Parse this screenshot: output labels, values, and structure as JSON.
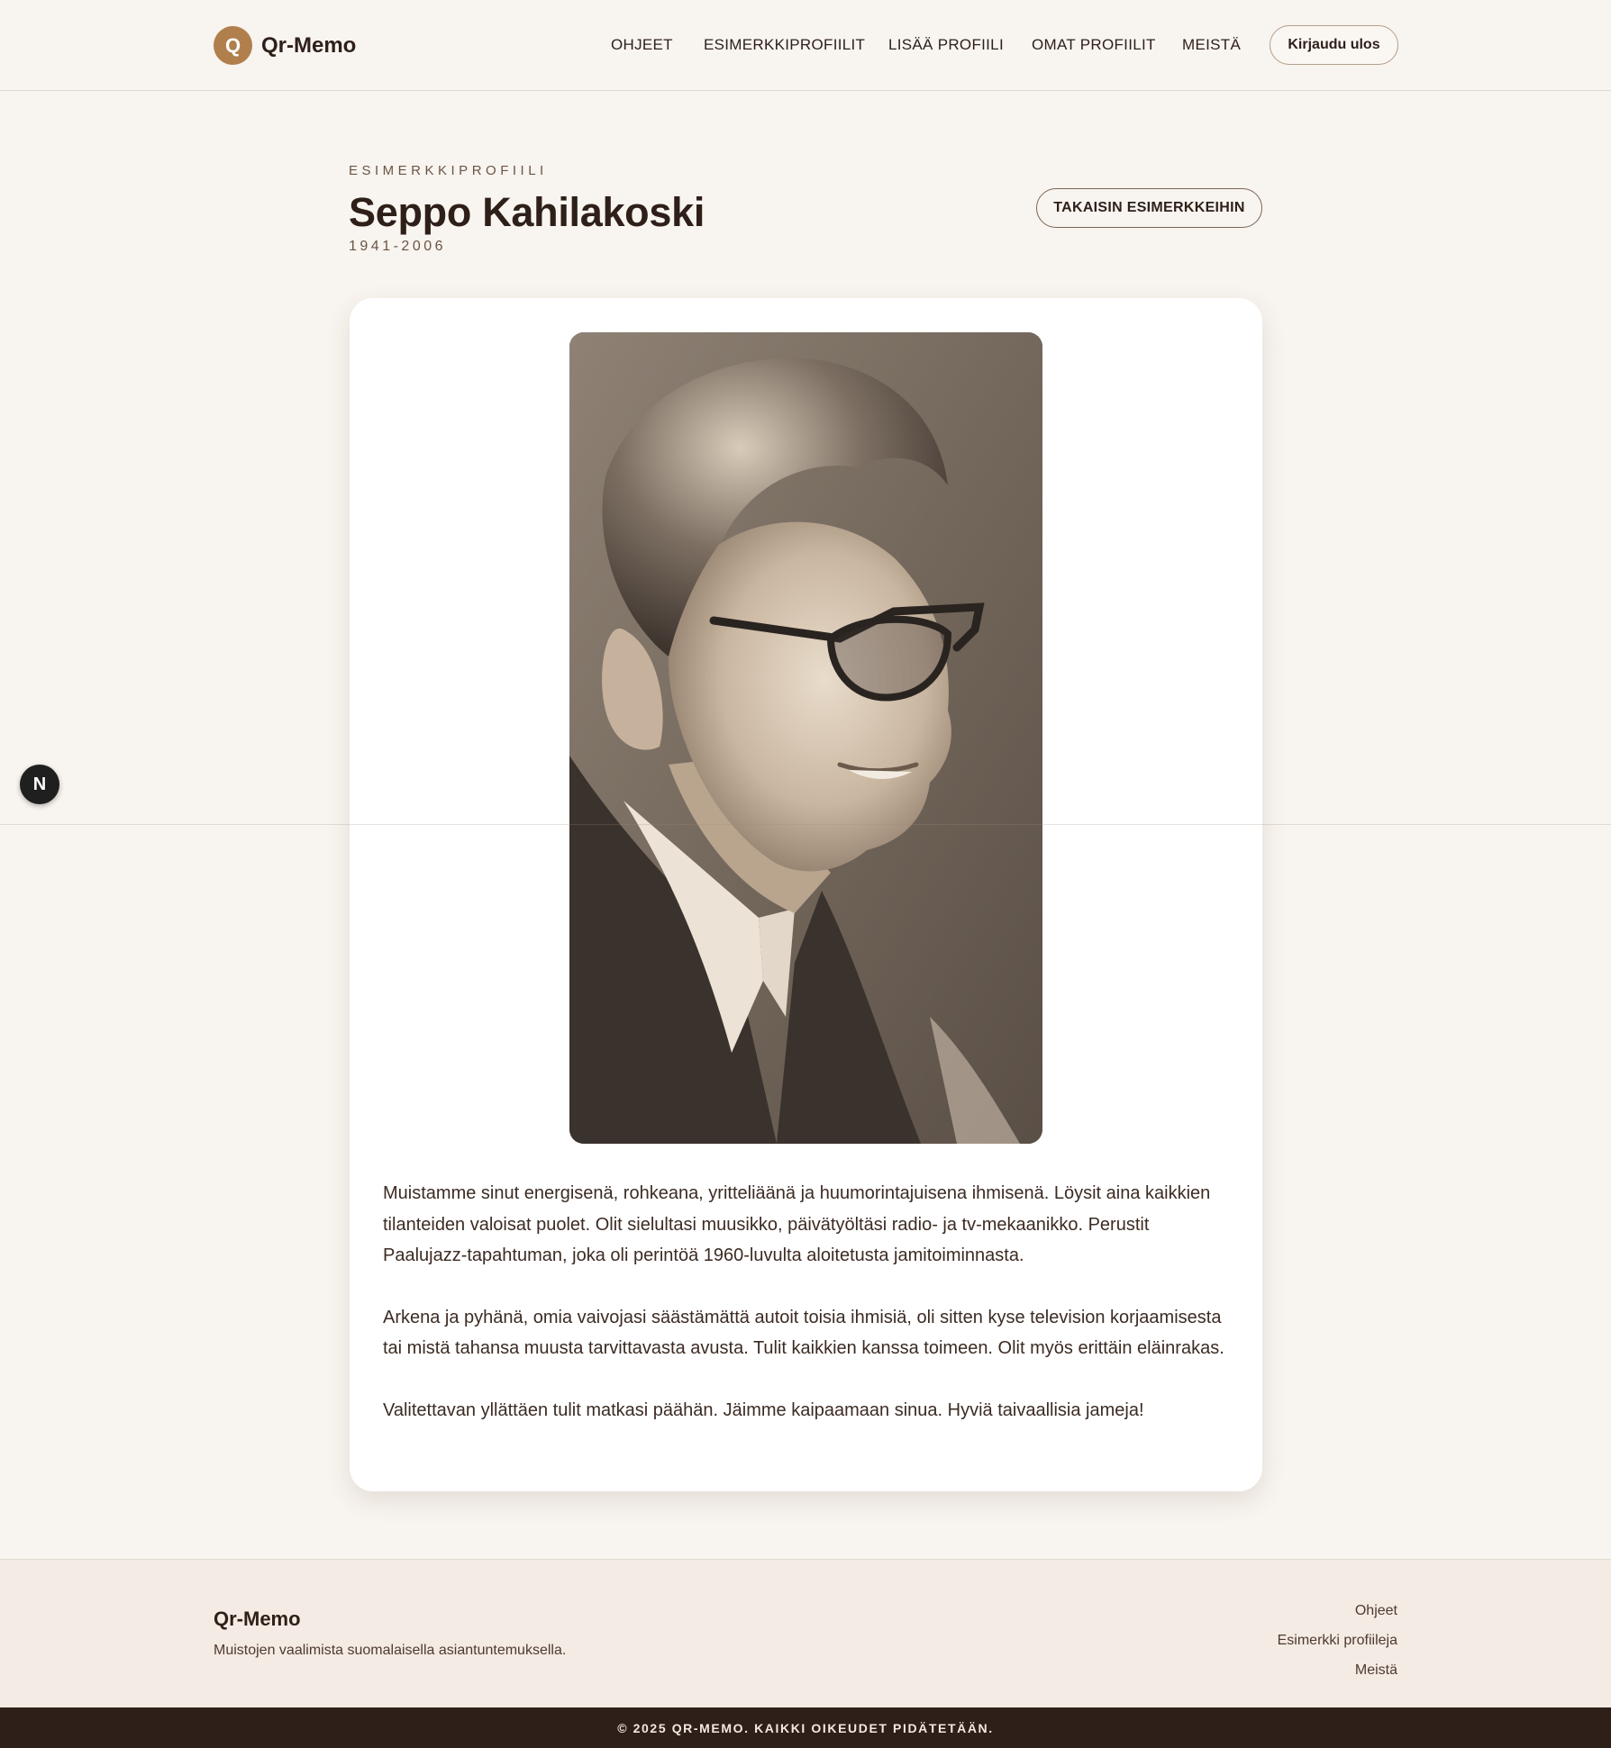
{
  "header": {
    "logo_mark": "Q",
    "logo_text": "Qr-Memo",
    "nav": [
      {
        "label": "OHJEET"
      },
      {
        "label": "ESIMERKKIPROFIILIT"
      },
      {
        "label": "LISÄÄ PROFIILI"
      },
      {
        "label": "OMAT PROFIILIT"
      },
      {
        "label": "MEISTÄ"
      }
    ],
    "logout_label": "Kirjaudu ulos"
  },
  "profile": {
    "eyebrow": "ESIMERKKIPROFIILI",
    "name": "Seppo Kahilakoski",
    "years": "1941-2006",
    "back_label": "TAKAISIN ESIMERKKEIHIN",
    "bio": [
      "Muistamme sinut energisenä, rohkeana, yritteliäänä ja huumorintajuisena ihmisenä. Löysit aina kaikkien tilanteiden valoisat puolet. Olit sielultasi muusikko, päivätyöltäsi radio- ja tv-mekaanikko. Perustit Paalujazz-tapahtuman, joka oli perintöä 1960-luvulta aloitetusta jamitoiminnasta.",
      "Arkena ja pyhänä, omia vaivojasi säästämättä autoit toisia ihmisiä, oli sitten kyse television korjaamisesta tai mistä tahansa muusta tarvittavasta avusta. Tulit kaikkien kanssa toimeen. Olit myös erittäin eläinrakas.",
      "Valitettavan yllättäen tulit matkasi päähän. Jäimme kaipaamaan sinua. Hyviä taivaallisia jameja!"
    ]
  },
  "dev_badge": "N",
  "footer": {
    "brand": "Qr-Memo",
    "tagline": "Muistojen vaalimista suomalaisella asiantuntemuksella.",
    "links": [
      {
        "label": "Ohjeet"
      },
      {
        "label": "Esimerkki profiileja"
      },
      {
        "label": "Meistä"
      }
    ],
    "copyright": "© 2025 QR-MEMO. KAIKKI OIKEUDET PIDÄTETÄÄN."
  },
  "colors": {
    "accent": "#b07f4c",
    "background": "#f8f4ef",
    "text": "#2e1f19",
    "footer_bar": "#2e1f19"
  }
}
